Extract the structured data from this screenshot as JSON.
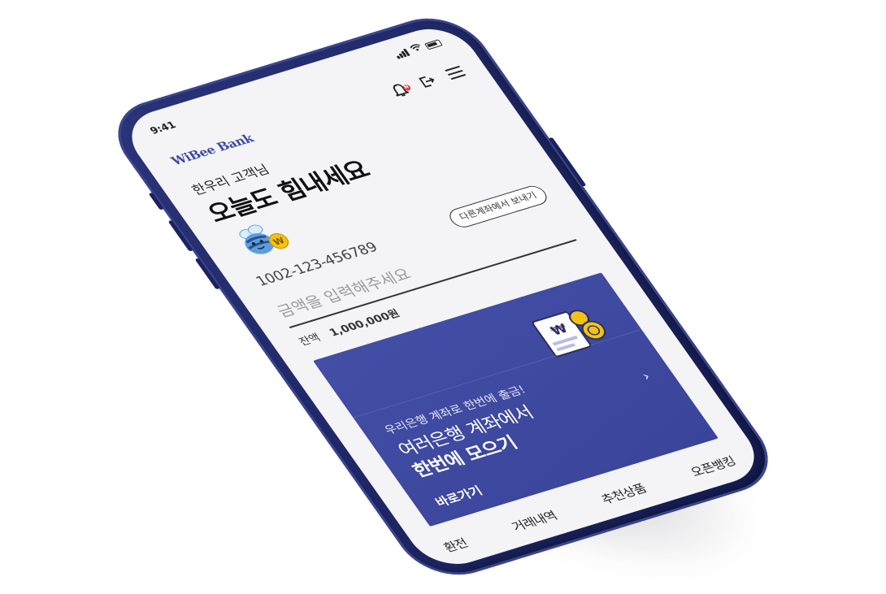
{
  "status_bar": {
    "time": "9:41"
  },
  "header": {
    "brand": "WiBee Bank",
    "bell_badge": "N"
  },
  "main": {
    "greeting": "한우리 고객님",
    "headline": "오늘도 힘내세요",
    "mascot_badge": "W",
    "account_number": "1002-123-456789",
    "transfer_button_label": "다른계좌에서 보내기",
    "amount_placeholder": "금액을 입력해주세요",
    "balance_label": "잔액",
    "balance_value": "1,000,000원"
  },
  "promo": {
    "illustration_symbol": "₩",
    "subtitle": "우리은행 계좌로 한번에 출금!",
    "title_line1": "여러은행 계좌에서",
    "title_line2": "한번에 모으기",
    "arrow": "›",
    "link_label": "바로가기"
  },
  "bottom_menu": {
    "items": [
      "환전",
      "거래내역",
      "추천상품",
      "오픈뱅킹"
    ]
  },
  "colors": {
    "frame": "#1f2866",
    "brand": "#3a4aa8",
    "promo_bg": "#434ea6",
    "badge_red": "#e8323c",
    "coin_gold": "#f2c316"
  }
}
